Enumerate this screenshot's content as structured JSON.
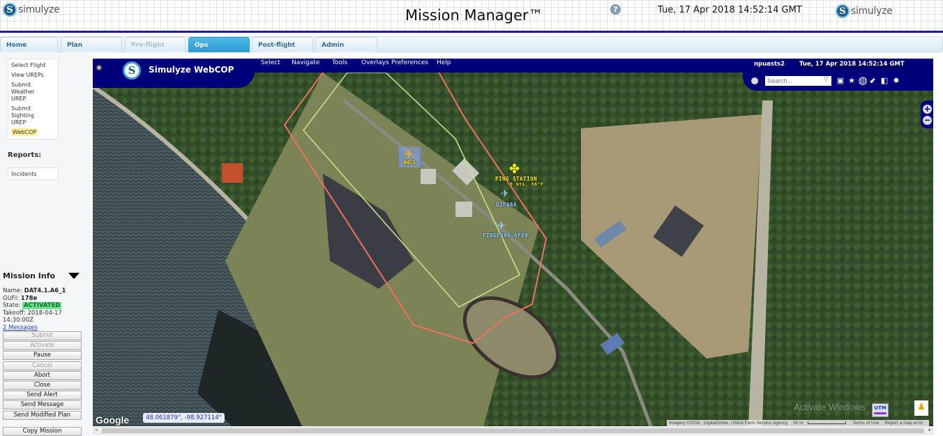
{
  "header": {
    "logo_text": "simulyze",
    "app_title": "Mission Manager™",
    "help_icon": "?",
    "clock": "Tue, 17 Apr 2018 14:52:14 GMT",
    "right_logo_text": "simulyze"
  },
  "tabs": [
    {
      "label": "Home",
      "state": "normal"
    },
    {
      "label": "Plan",
      "state": "normal"
    },
    {
      "label": "Pre-flight",
      "state": "disabled"
    },
    {
      "label": "Ops",
      "state": "active"
    },
    {
      "label": "Post-flight",
      "state": "normal"
    },
    {
      "label": "Admin",
      "state": "normal"
    }
  ],
  "sidebar": {
    "links": [
      {
        "label": "Select Flight"
      },
      {
        "label": "View UREPs"
      },
      {
        "label": "Submit Weather UREP"
      },
      {
        "label": "Submit Sighting UREP"
      },
      {
        "label": "WebCOP",
        "highlighted": true
      }
    ],
    "reports_heading": "Reports:",
    "reports": [
      {
        "label": "Incidents"
      }
    ]
  },
  "mission_info": {
    "title": "Mission Info",
    "name_label": "Name:",
    "name": "DAT4.1.A6_1",
    "gufi_label": "GUFI:",
    "gufi": "178e",
    "state_label": "State:",
    "state": "ACTIVATED",
    "takeoff_label": "Takeoff:",
    "takeoff_date": "2018-04-17",
    "takeoff_time": "14:30:00Z",
    "messages_link": "2 Messages",
    "buttons": [
      {
        "label": "Submit",
        "enabled": false
      },
      {
        "label": "Activate",
        "enabled": false
      },
      {
        "label": "Pause",
        "enabled": true
      },
      {
        "label": "Cancel",
        "enabled": false
      },
      {
        "label": "Abort",
        "enabled": true
      },
      {
        "label": "Close",
        "enabled": true
      },
      {
        "label": "Send Alert",
        "enabled": true
      },
      {
        "label": "Send Message",
        "enabled": true
      },
      {
        "label": "Send Modified Plan",
        "enabled": true
      }
    ],
    "copy_button": "Copy Mission"
  },
  "webcop": {
    "brand": "Simulyze WebCOP",
    "menu": [
      "Select",
      "Navigate",
      "Tools",
      "Overlays",
      "Preferences",
      "Help"
    ],
    "user": "npuasts2",
    "clock": "Tue, 17 Apr 2018 14:52:14 GMT",
    "search_placeholder": "Search...",
    "toolbar_icons": [
      "image-icon",
      "star-icon",
      "globe-icon",
      "arrow-icon",
      "panel-icon",
      "gear-icon"
    ],
    "zoom_in": "+",
    "zoom_out": "−",
    "aircraft": [
      {
        "id": "A6-1",
        "selected": true,
        "color": "#ffb020"
      },
      {
        "id": "PING STATION",
        "sub": "9 kts, 56°F",
        "color": "#fff000"
      },
      {
        "id": "D2F0A6",
        "color": "#9ad8ff"
      },
      {
        "id": "PINGF0A6-6F80",
        "color": "#9ad8ff"
      }
    ],
    "polygons": {
      "outer_color": "#f07060",
      "inner_color": "#c8e68a"
    },
    "google_logo": "Google",
    "coordinates": "48.061879°, -98.927114°",
    "attribution": "Imagery ©2018 , DigitalGlobe, USDA Farm Service Agency",
    "scale": "50 m",
    "terms": "Terms of Use",
    "report_error": "Report a map error",
    "utm_button": "UTM",
    "watermark": "Activate Windows"
  }
}
